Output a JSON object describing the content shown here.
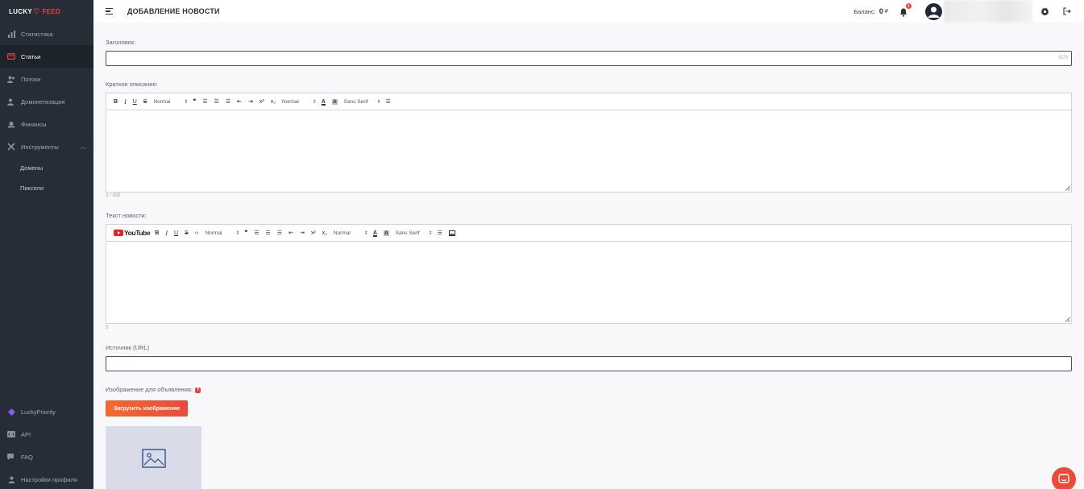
{
  "app": {
    "logo_left": "LUCKY",
    "logo_right": "FEED"
  },
  "header": {
    "title": "ДОБАВЛЕНИЕ НОВОСТИ",
    "balance_label": "Баланс:",
    "balance_value": "0",
    "balance_currency": "₽",
    "notifications_count": "1",
    "menu_icon": "hamburger-icon",
    "settings_icon": "gear-icon",
    "logout_icon": "logout-icon"
  },
  "sidebar": {
    "items": [
      {
        "label": "Статистика",
        "icon": "bar-chart-icon"
      },
      {
        "label": "Статьи",
        "icon": "article-icon",
        "active": true
      },
      {
        "label": "Потоки",
        "icon": "users-icon"
      },
      {
        "label": "Домонетизация",
        "icon": "user-money-icon"
      },
      {
        "label": "Финансы",
        "icon": "wallet-icon"
      },
      {
        "label": "Инструменты",
        "icon": "tools-icon",
        "expanded": true
      }
    ],
    "sub_items": [
      {
        "label": "Домены"
      },
      {
        "label": "Пиксели"
      }
    ],
    "bottom_items": [
      {
        "label": "LuckyPriority",
        "icon": "diamond-icon"
      },
      {
        "label": "API",
        "icon": "code-icon"
      },
      {
        "label": "FAQ",
        "icon": "chat-icon"
      },
      {
        "label": "Настройки профиля",
        "icon": "user-icon"
      }
    ]
  },
  "form": {
    "title_label": "Заголовок:",
    "title_value": "",
    "title_counter": "0/70",
    "desc_label": "Краткое описание:",
    "desc_counter": "0 / 300",
    "text_label": "Текст новости:",
    "text_counter": "0",
    "source_label": "Источник (URL)",
    "source_value": "",
    "image_label": "Изображение для объявления:",
    "image_help": "?",
    "upload_button": "Загрузить изображение"
  },
  "toolbar": {
    "bold": "B",
    "italic": "I",
    "underline": "U",
    "strike": "S",
    "code": "‹›",
    "header_select": "Normal",
    "quote": "❞",
    "superscript": "x²",
    "subscript": "x₂",
    "size_select": "Normal",
    "color": "A",
    "background": "A",
    "font_select": "Sans Serif",
    "youtube": "YouTube"
  }
}
